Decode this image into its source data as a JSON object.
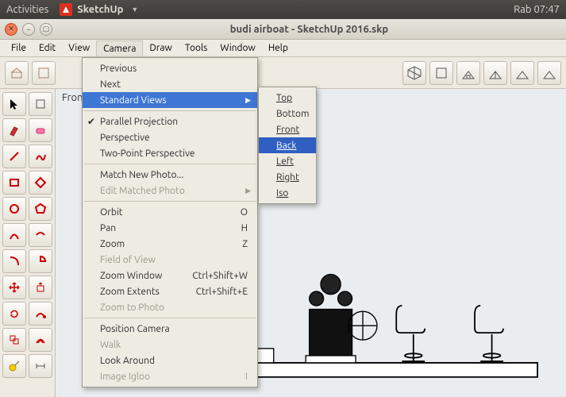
{
  "panel": {
    "activities": "Activities",
    "app_name": "SketchUp",
    "clock": "Rab 07:47"
  },
  "window": {
    "title": "budi airboat - SketchUp 2016.skp"
  },
  "menubar": [
    "File",
    "Edit",
    "View",
    "Camera",
    "Draw",
    "Tools",
    "Window",
    "Help"
  ],
  "camera_menu": {
    "previous": "Previous",
    "next": "Next",
    "standard_views": "Standard Views",
    "parallel": "Parallel Projection",
    "perspective": "Perspective",
    "two_point": "Two-Point Perspective",
    "match_new": "Match New Photo...",
    "edit_matched": "Edit Matched Photo",
    "orbit": "Orbit",
    "orbit_k": "O",
    "pan": "Pan",
    "pan_k": "H",
    "zoom": "Zoom",
    "zoom_k": "Z",
    "fov": "Field of View",
    "zoom_window": "Zoom Window",
    "zoom_window_k": "Ctrl+Shift+W",
    "zoom_extents": "Zoom Extents",
    "zoom_extents_k": "Ctrl+Shift+E",
    "zoom_photo": "Zoom to Photo",
    "position": "Position Camera",
    "walk": "Walk",
    "look": "Look Around",
    "igloo": "Image Igloo",
    "igloo_k": "I"
  },
  "std_views": {
    "top": "Top",
    "bottom": "Bottom",
    "front": "Front",
    "back": "Back",
    "left": "Left",
    "right": "Right",
    "iso": "Iso"
  },
  "viewport": {
    "label": "Front"
  }
}
